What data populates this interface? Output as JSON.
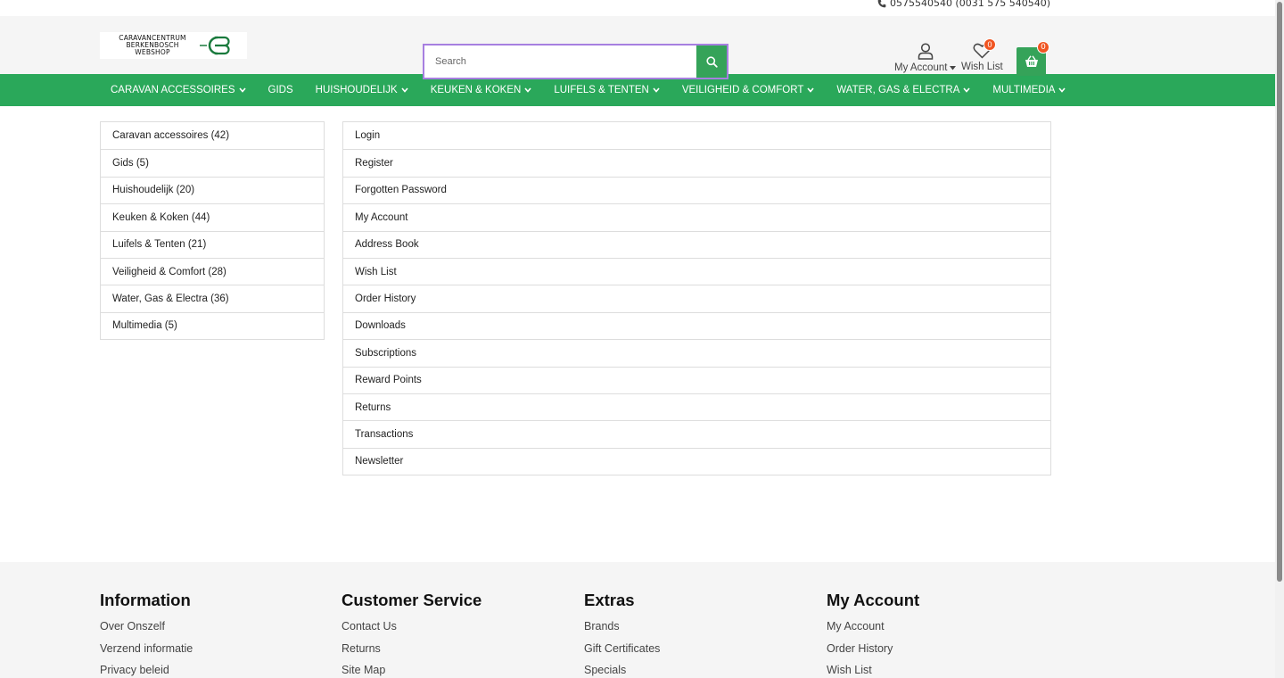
{
  "topbar": {
    "phone": "0575540540 (0031 575 540540)"
  },
  "logo": {
    "line1": "CARAVANCENTRUM",
    "line2": "BERKENBOSCH",
    "line3": "WEBSHOP"
  },
  "search": {
    "placeholder": "Search"
  },
  "header": {
    "account_label": "My Account",
    "wishlist_label": "Wish List",
    "wishlist_count": "0",
    "cart_count": "0"
  },
  "nav": [
    {
      "label": "CARAVAN ACCESSOIRES",
      "dropdown": true
    },
    {
      "label": "GIDS",
      "dropdown": false
    },
    {
      "label": "HUISHOUDELIJK",
      "dropdown": true
    },
    {
      "label": "KEUKEN & KOKEN",
      "dropdown": true
    },
    {
      "label": "LUIFELS & TENTEN",
      "dropdown": true
    },
    {
      "label": "VEILIGHEID & COMFORT",
      "dropdown": true
    },
    {
      "label": "WATER, GAS & ELECTRA",
      "dropdown": true
    },
    {
      "label": "MULTIMEDIA",
      "dropdown": true
    }
  ],
  "categories": [
    "Caravan accessoires (42)",
    "Gids (5)",
    "Huishoudelijk (20)",
    "Keuken & Koken (44)",
    "Luifels & Tenten (21)",
    "Veiligheid & Comfort (28)",
    "Water, Gas & Electra (36)",
    "Multimedia (5)"
  ],
  "account_links": [
    "Login",
    "Register",
    "Forgotten Password",
    "My Account",
    "Address Book",
    "Wish List",
    "Order History",
    "Downloads",
    "Subscriptions",
    "Reward Points",
    "Returns",
    "Transactions",
    "Newsletter"
  ],
  "footer": {
    "information": {
      "title": "Information",
      "links": [
        "Over Onszelf",
        "Verzend informatie",
        "Privacy beleid"
      ]
    },
    "customer_service": {
      "title": "Customer Service",
      "links": [
        "Contact Us",
        "Returns",
        "Site Map"
      ]
    },
    "extras": {
      "title": "Extras",
      "links": [
        "Brands",
        "Gift Certificates",
        "Specials"
      ]
    },
    "my_account": {
      "title": "My Account",
      "links": [
        "My Account",
        "Order History",
        "Wish List"
      ]
    }
  },
  "colors": {
    "green": "#2aa85a",
    "badge": "#f05522",
    "search_border": "#a77fe0"
  }
}
